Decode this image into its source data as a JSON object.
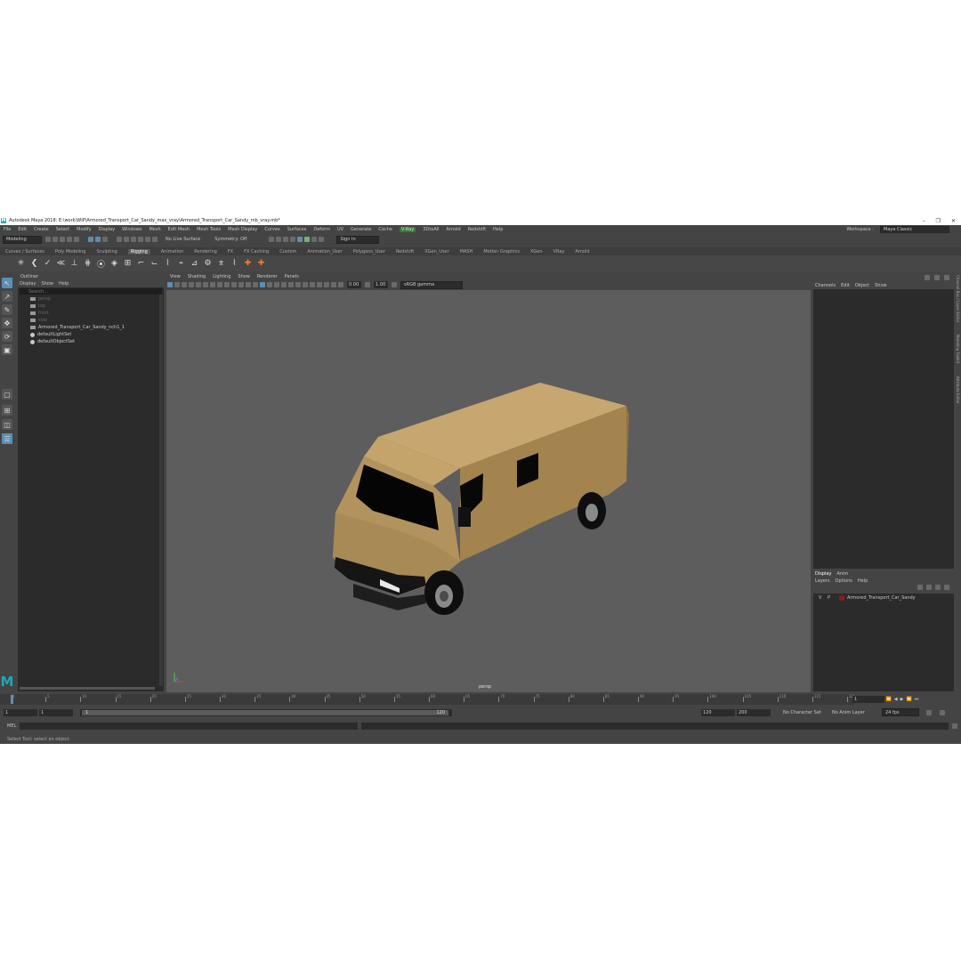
{
  "window": {
    "title": "Autodesk Maya 2018: E:\\work\\WIP\\Armored_Transport_Car_Sandy_max_vray\\Armored_Transport_Car_Sandy_mb_vray.mb*",
    "logo": "M",
    "minimize": "–",
    "maximize": "❐",
    "close": "✕"
  },
  "menu": [
    "File",
    "Edit",
    "Create",
    "Select",
    "Modify",
    "Display",
    "Windows",
    "Mesh",
    "Edit Mesh",
    "Mesh Tools",
    "Mesh Display",
    "Curves",
    "Surfaces",
    "Deform",
    "UV",
    "Generate",
    "Cache",
    "V-Ray",
    "3DtoAll",
    "Arnold",
    "Redshift",
    "Help"
  ],
  "workspace": {
    "label": "Workspace :",
    "value": "Maya Classic"
  },
  "status": {
    "mode": "Modeling",
    "live_surface": "No Live Surface",
    "symmetry": "Symmetry: Off",
    "sign_in": "Sign In"
  },
  "shelf_tabs": [
    "Curves / Surfaces",
    "Poly Modeling",
    "Sculpting",
    "Rigging",
    "Animation",
    "Rendering",
    "FX",
    "FX Caching",
    "Custom",
    "Animation_User",
    "Polygons_User",
    "Redshift",
    "XGen_User",
    "MASH",
    "Motion Graphics",
    "XGen",
    "VRay",
    "Arnold"
  ],
  "shelf_active": "Rigging",
  "shelf_icons": [
    "✳",
    "❮",
    "✓",
    "≪",
    "⊥",
    "⋕",
    "⦿",
    "◈",
    "⊞",
    "⌐",
    "⌙",
    "⌇",
    "⌁",
    "⊿",
    "⚙",
    "⌆",
    "⌇",
    "✚",
    "✚"
  ],
  "outliner": {
    "title": "Outliner",
    "menu": [
      "Display",
      "Show",
      "Help"
    ],
    "search_placeholder": "Search...",
    "items": [
      {
        "label": "persp",
        "dim": true
      },
      {
        "label": "top",
        "dim": true
      },
      {
        "label": "front",
        "dim": true
      },
      {
        "label": "side",
        "dim": true
      },
      {
        "label": "Armored_Transport_Car_Sandy_nch1_1",
        "dim": false
      },
      {
        "label": "defaultLightSet",
        "dim": false
      },
      {
        "label": "defaultObjectSet",
        "dim": false
      }
    ]
  },
  "viewport": {
    "menu": [
      "View",
      "Shading",
      "Lighting",
      "Show",
      "Renderer",
      "Panels"
    ],
    "exposure": "0.00",
    "gamma": "1.00",
    "color_space": "sRGB gamma",
    "camera": "persp",
    "model_color": "#b3935d"
  },
  "channel_box": {
    "menu": [
      "Channels",
      "Edit",
      "Object",
      "Show"
    ]
  },
  "layers": {
    "tabs": [
      "Display",
      "Anim"
    ],
    "menu": [
      "Layers",
      "Options",
      "Help"
    ],
    "layer": {
      "v": "V",
      "p": "P",
      "name": "Armored_Transport_Car_Sandy",
      "color": "#8b1a1a"
    }
  },
  "sidebar_tabs": [
    "Channel Box / Layer Editor",
    "Modeling Toolkit",
    "Attribute Editor"
  ],
  "timeline": {
    "ticks": [
      "1",
      "5",
      "10",
      "15",
      "20",
      "25",
      "30",
      "35",
      "40",
      "45",
      "50",
      "55",
      "60",
      "65",
      "70",
      "75",
      "80",
      "85",
      "90",
      "95",
      "100",
      "105",
      "110",
      "115",
      "120"
    ],
    "current_frame": "1"
  },
  "range": {
    "start": "1",
    "start_inner": "1",
    "slider_start": "1",
    "slider_end": "120",
    "end_inner": "120",
    "end": "200",
    "character_set": "No Character Set",
    "anim_layer": "No Anim Layer",
    "fps": "24 fps"
  },
  "command": {
    "label": "MEL"
  },
  "help_line": "Select Tool: select an object"
}
